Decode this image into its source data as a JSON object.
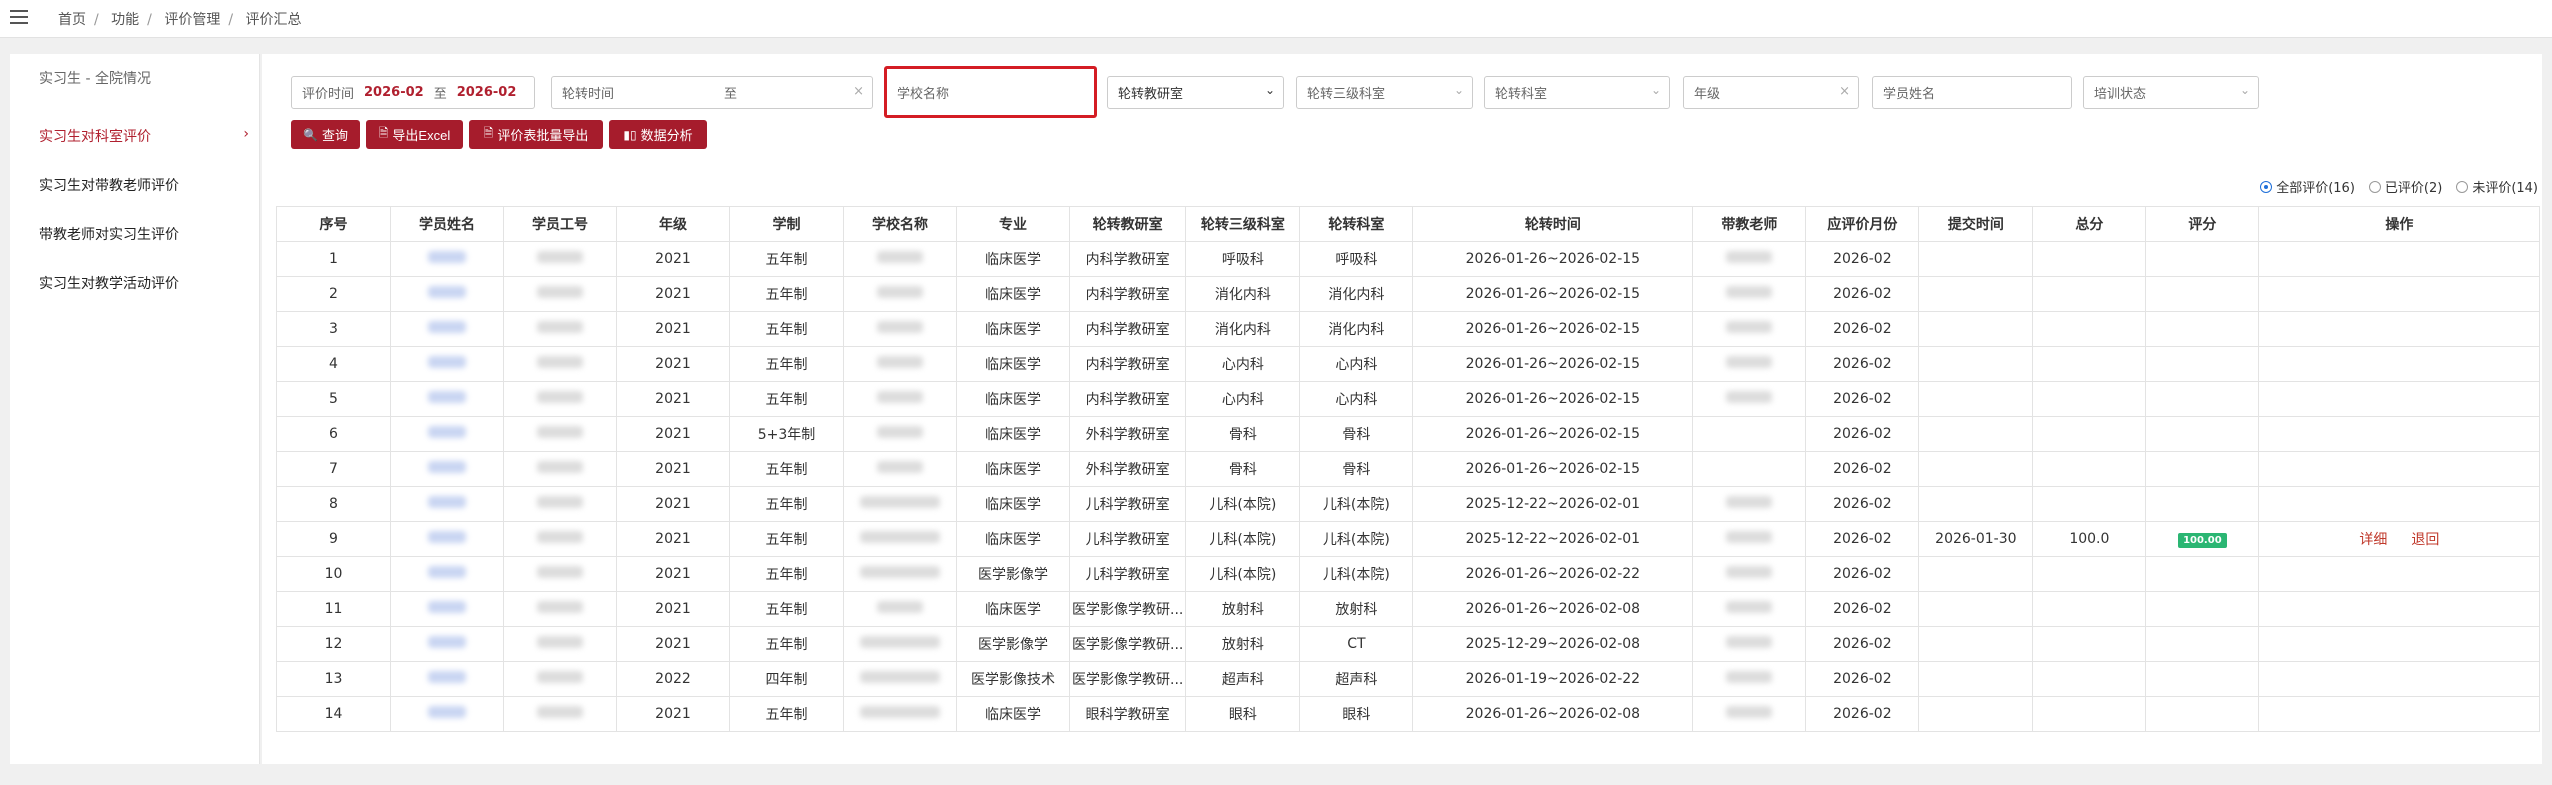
{
  "breadcrumb": [
    "首页",
    "功能",
    "评价管理",
    "评价汇总"
  ],
  "sidebar": {
    "title": "实习生 - 全院情况",
    "items": [
      {
        "label": "实习生对科室评价",
        "active": true
      },
      {
        "label": "实习生对带教老师评价",
        "active": false
      },
      {
        "label": "带教老师对实习生评价",
        "active": false
      },
      {
        "label": "实习生对教学活动评价",
        "active": false
      }
    ]
  },
  "filters": {
    "eval_time": {
      "label": "评价时间",
      "start": "2026-02",
      "to": "至",
      "end": "2026-02"
    },
    "rotation_time": {
      "label": "轮转时间",
      "to": "至",
      "clear": "×"
    },
    "school_placeholder": "学校名称",
    "teaching_room": "轮转教研室",
    "level3_dept": "轮转三级科室",
    "dept": "轮转科室",
    "grade": "年级",
    "grade_clear": "×",
    "student_name_placeholder": "学员姓名",
    "training_status": "培训状态"
  },
  "actions": {
    "query": "查询",
    "export_excel": "导出Excel",
    "batch_export": "评价表批量导出",
    "analysis": "数据分析"
  },
  "radios": [
    {
      "label": "全部评价(16)",
      "checked": true
    },
    {
      "label": "已评价(2)",
      "checked": false
    },
    {
      "label": "未评价(14)",
      "checked": false
    }
  ],
  "table": {
    "headers": [
      "序号",
      "学员姓名",
      "学员工号",
      "年级",
      "学制",
      "学校名称",
      "专业",
      "轮转教研室",
      "轮转三级科室",
      "轮转科室",
      "轮转时间",
      "带教老师",
      "应评价月份",
      "提交时间",
      "总分",
      "评分",
      "操作"
    ],
    "rows": [
      {
        "no": "1",
        "grade": "2021",
        "system": "五年制",
        "major": "临床医学",
        "room": "内科学教研室",
        "l3": "呼吸科",
        "dept": "呼吸科",
        "time": "2026-01-26~2026-02-15",
        "month": "2026-02",
        "submit": "",
        "total": "",
        "score": "",
        "ops": false,
        "teacher": true
      },
      {
        "no": "2",
        "grade": "2021",
        "system": "五年制",
        "major": "临床医学",
        "room": "内科学教研室",
        "l3": "消化内科",
        "dept": "消化内科",
        "time": "2026-01-26~2026-02-15",
        "month": "2026-02",
        "submit": "",
        "total": "",
        "score": "",
        "ops": false,
        "teacher": true
      },
      {
        "no": "3",
        "grade": "2021",
        "system": "五年制",
        "major": "临床医学",
        "room": "内科学教研室",
        "l3": "消化内科",
        "dept": "消化内科",
        "time": "2026-01-26~2026-02-15",
        "month": "2026-02",
        "submit": "",
        "total": "",
        "score": "",
        "ops": false,
        "teacher": true
      },
      {
        "no": "4",
        "grade": "2021",
        "system": "五年制",
        "major": "临床医学",
        "room": "内科学教研室",
        "l3": "心内科",
        "dept": "心内科",
        "time": "2026-01-26~2026-02-15",
        "month": "2026-02",
        "submit": "",
        "total": "",
        "score": "",
        "ops": false,
        "teacher": true
      },
      {
        "no": "5",
        "grade": "2021",
        "system": "五年制",
        "major": "临床医学",
        "room": "内科学教研室",
        "l3": "心内科",
        "dept": "心内科",
        "time": "2026-01-26~2026-02-15",
        "month": "2026-02",
        "submit": "",
        "total": "",
        "score": "",
        "ops": false,
        "teacher": true
      },
      {
        "no": "6",
        "grade": "2021",
        "system": "5+3年制",
        "major": "临床医学",
        "room": "外科学教研室",
        "l3": "骨科",
        "dept": "骨科",
        "time": "2026-01-26~2026-02-15",
        "month": "2026-02",
        "submit": "",
        "total": "",
        "score": "",
        "ops": false,
        "teacher": false
      },
      {
        "no": "7",
        "grade": "2021",
        "system": "五年制",
        "major": "临床医学",
        "room": "外科学教研室",
        "l3": "骨科",
        "dept": "骨科",
        "time": "2026-01-26~2026-02-15",
        "month": "2026-02",
        "submit": "",
        "total": "",
        "score": "",
        "ops": false,
        "teacher": false
      },
      {
        "no": "8",
        "grade": "2021",
        "system": "五年制",
        "major": "临床医学",
        "room": "儿科学教研室",
        "l3": "儿科(本院)",
        "dept": "儿科(本院)",
        "time": "2025-12-22~2026-02-01",
        "month": "2026-02",
        "submit": "",
        "total": "",
        "score": "",
        "ops": false,
        "teacher": true
      },
      {
        "no": "9",
        "grade": "2021",
        "system": "五年制",
        "major": "临床医学",
        "room": "儿科学教研室",
        "l3": "儿科(本院)",
        "dept": "儿科(本院)",
        "time": "2025-12-22~2026-02-01",
        "month": "2026-02",
        "submit": "2026-01-30",
        "total": "100.0",
        "score": "100.00",
        "ops": true,
        "teacher": true
      },
      {
        "no": "10",
        "grade": "2021",
        "system": "五年制",
        "major": "医学影像学",
        "room": "儿科学教研室",
        "l3": "儿科(本院)",
        "dept": "儿科(本院)",
        "time": "2026-01-26~2026-02-22",
        "month": "2026-02",
        "submit": "",
        "total": "",
        "score": "",
        "ops": false,
        "teacher": true
      },
      {
        "no": "11",
        "grade": "2021",
        "system": "五年制",
        "major": "临床医学",
        "room": "医学影像学教研...",
        "l3": "放射科",
        "dept": "放射科",
        "time": "2026-01-26~2026-02-08",
        "month": "2026-02",
        "submit": "",
        "total": "",
        "score": "",
        "ops": false,
        "teacher": true
      },
      {
        "no": "12",
        "grade": "2021",
        "system": "五年制",
        "major": "医学影像学",
        "room": "医学影像学教研...",
        "l3": "放射科",
        "dept": "CT",
        "time": "2025-12-29~2026-02-08",
        "month": "2026-02",
        "submit": "",
        "total": "",
        "score": "",
        "ops": false,
        "teacher": true
      },
      {
        "no": "13",
        "grade": "2022",
        "system": "四年制",
        "major": "医学影像技术",
        "room": "医学影像学教研...",
        "l3": "超声科",
        "dept": "超声科",
        "time": "2026-01-19~2026-02-22",
        "month": "2026-02",
        "submit": "",
        "total": "",
        "score": "",
        "ops": false,
        "teacher": true
      },
      {
        "no": "14",
        "grade": "2021",
        "system": "五年制",
        "major": "临床医学",
        "room": "眼科学教研室",
        "l3": "眼科",
        "dept": "眼科",
        "time": "2026-01-26~2026-02-08",
        "month": "2026-02",
        "submit": "",
        "total": "",
        "score": "",
        "ops": false,
        "teacher": true
      }
    ],
    "op_detail": "详细",
    "op_return": "退回"
  },
  "colors": {
    "accent": "#a61c2c",
    "active_nav": "#b0202f",
    "badge": "#2bb673",
    "highlight": "#d41d24"
  }
}
